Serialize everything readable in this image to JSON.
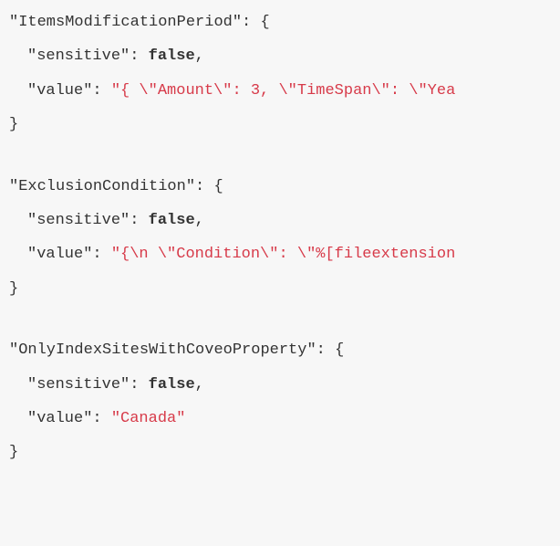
{
  "entries": [
    {
      "key": "ItemsModificationPeriod",
      "sensitive": "false",
      "value": "\"{ \\\"Amount\\\": 3, \\\"TimeSpan\\\": \\\"Yea"
    },
    {
      "key": "ExclusionCondition",
      "sensitive": "false",
      "value": "\"{\\n \\\"Condition\\\": \\\"%[fileextension"
    },
    {
      "key": "OnlyIndexSitesWithCoveoProperty",
      "sensitive": "false",
      "value": "\"Canada\""
    }
  ],
  "labels": {
    "sensitive": "sensitive",
    "value": "value"
  },
  "punct": {
    "colon_brace": ": {",
    "colon": ": ",
    "comma": ",",
    "close_brace": "}",
    "quote": "\""
  }
}
